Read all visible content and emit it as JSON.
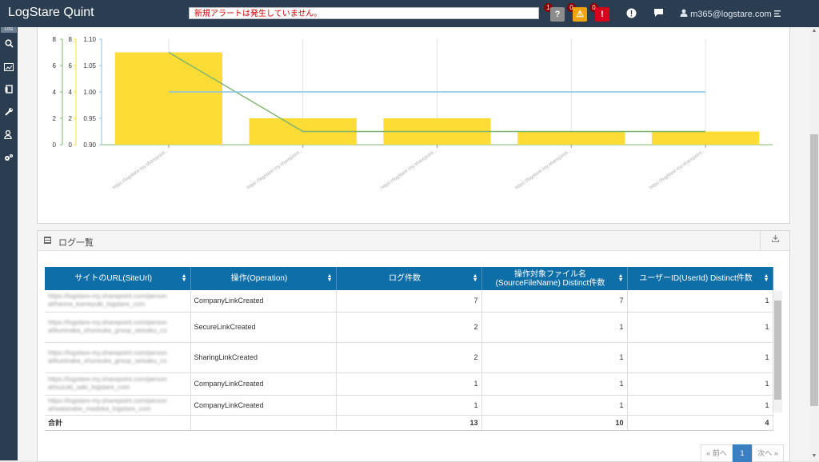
{
  "app": {
    "title": "LogStare Quint"
  },
  "alert": {
    "message": "新規アラートは発生していません。"
  },
  "status": [
    {
      "count": "1",
      "icon": "?",
      "color": "#8c8c8c",
      "name": "unknown"
    },
    {
      "count": "0",
      "icon": "⚠",
      "color": "#f0a30a",
      "name": "warning"
    },
    {
      "count": "0",
      "icon": "!",
      "color": "#d9001b",
      "name": "critical"
    }
  ],
  "header": {
    "user": "m365@logstare.com"
  },
  "nav": {
    "tag": "LOG"
  },
  "chart_data": {
    "type": "bar",
    "categories": [
      "https://logstare-my.sharepoint...",
      "https://logstare-my.sharepoint...",
      "https://logstare-my.sharepoint...",
      "https://logstare-my.sharepoint...",
      "https://logstare-my.sharepoint..."
    ],
    "series": [
      {
        "type": "bar",
        "values": [
          7,
          2,
          2,
          1,
          1
        ],
        "color": "#fddc35"
      },
      {
        "type": "line",
        "values": [
          7,
          1,
          1,
          1,
          1
        ],
        "color": "#7cb46e"
      },
      {
        "type": "line",
        "values": [
          1,
          1,
          1,
          1,
          1
        ],
        "color": "#87c5e0"
      }
    ],
    "axes": [
      {
        "ticks": [
          "8",
          "6",
          "4",
          "2",
          "0"
        ],
        "color": "#7cb46e",
        "range": [
          0,
          8
        ]
      },
      {
        "ticks": [
          "8",
          "6",
          "4",
          "2",
          "0"
        ],
        "color": "#fddc35",
        "range": [
          0,
          8
        ]
      },
      {
        "ticks": [
          "1.10",
          "1.05",
          "1.00",
          "0.95",
          "0.90"
        ],
        "color": "#87c5e0",
        "range": [
          0.9,
          1.1
        ]
      }
    ]
  },
  "log": {
    "title": "ログ一覧",
    "columns": [
      "サイトのURL(SiteUrl)",
      "操作(Operation)",
      "ログ件数",
      "操作対象ファイル名(SourceFileName) Distinct件数",
      "ユーザーID(UserId) Distinct件数"
    ],
    "rows": [
      {
        "url": "https://logstare-my.sharepoint.com/person al/hanna_kameyuki_logstare_com",
        "op": "CompanyLinkCreated",
        "count": "7",
        "files": "7",
        "users": "1"
      },
      {
        "url": "https://logstare-my.sharepoint.com/person al/kuninaka_shunsuke_group_seisaku_co",
        "op": "SecureLinkCreated",
        "count": "2",
        "files": "1",
        "users": "1"
      },
      {
        "url": "https://logstare-my.sharepoint.com/person al/kuninaka_shunsuke_group_seisaku_co",
        "op": "SharingLinkCreated",
        "count": "2",
        "files": "1",
        "users": "1"
      },
      {
        "url": "https://logstare-my.sharepoint.com/person al/suzuki_saki_logstare_com",
        "op": "CompanyLinkCreated",
        "count": "1",
        "files": "1",
        "users": "1"
      },
      {
        "url": "https://logstare-my.sharepoint.com/person al/watanabe_madoka_logstare_com",
        "op": "CompanyLinkCreated",
        "count": "1",
        "files": "1",
        "users": "1"
      }
    ],
    "total": {
      "label": "合計",
      "count": "13",
      "files": "10",
      "users": "4"
    }
  },
  "pager": {
    "prev": "« 前へ",
    "current": "1",
    "next": "次へ »"
  }
}
